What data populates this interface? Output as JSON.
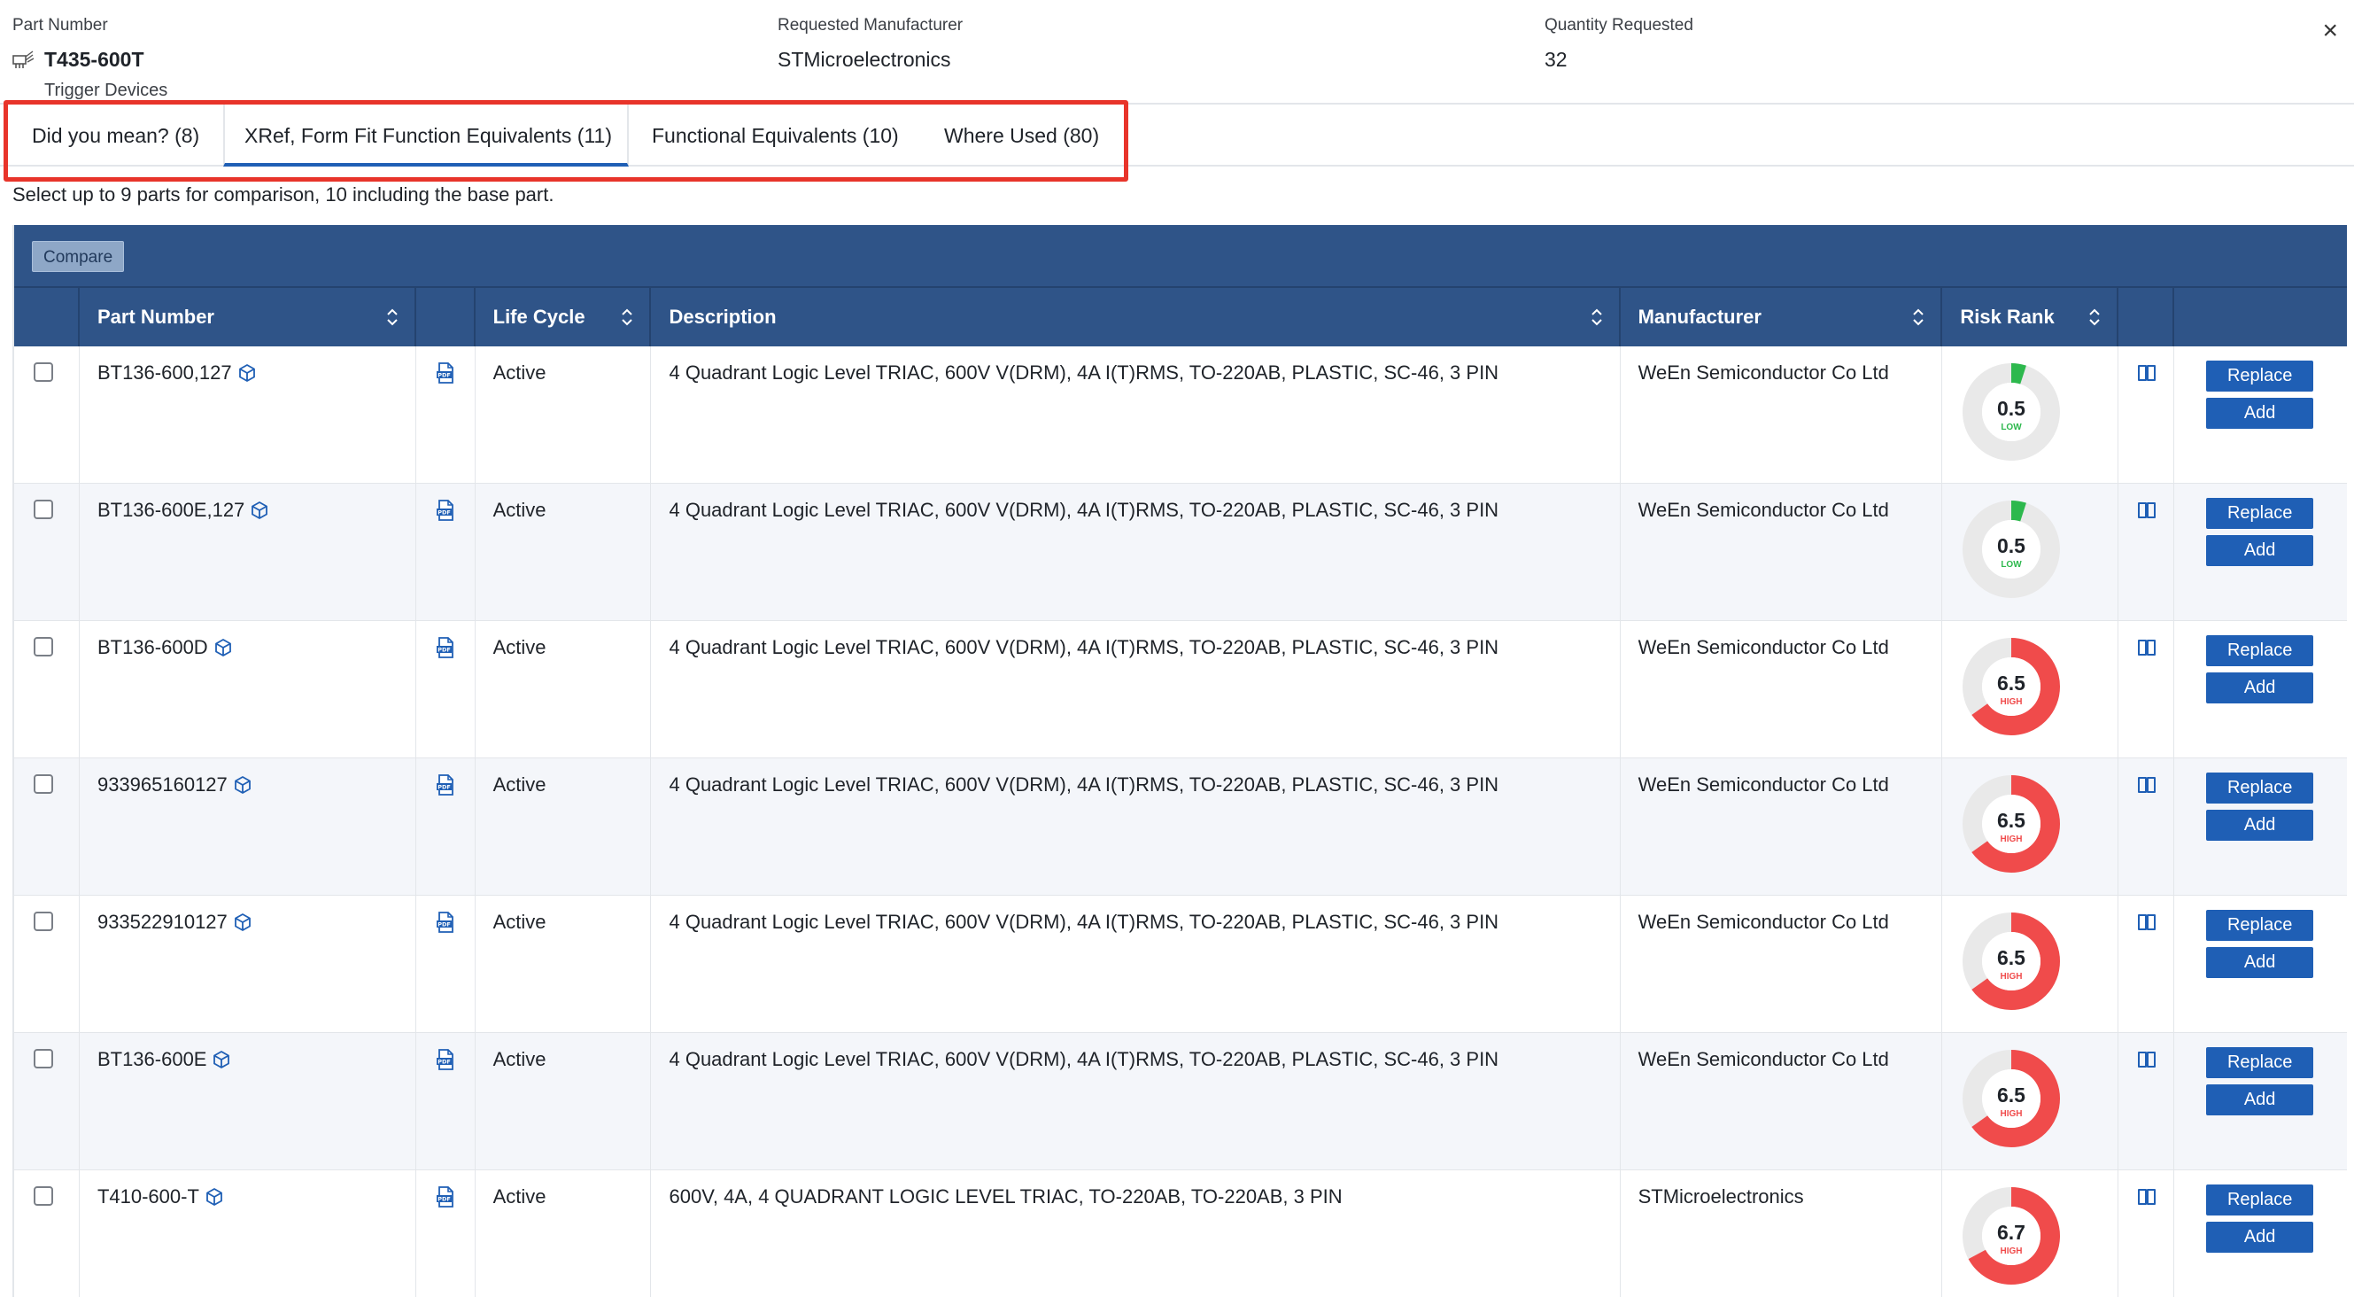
{
  "header": {
    "part_number_label": "Part Number",
    "part_number": "T435-600T",
    "part_category": "Trigger Devices",
    "manufacturer_label": "Requested Manufacturer",
    "manufacturer": "STMicroelectronics",
    "quantity_label": "Quantity Requested",
    "quantity": "32",
    "close_symbol": "×"
  },
  "tabs": [
    {
      "label": "Did you mean? (8)",
      "active": false
    },
    {
      "label": "XRef, Form Fit Function Equivalents (11)",
      "active": true
    },
    {
      "label": "Functional Equivalents (10)",
      "active": false
    },
    {
      "label": "Where Used (80)",
      "active": false
    }
  ],
  "hint": "Select up to 9 parts for comparison, 10 including the base part.",
  "toolbar": {
    "compare_label": "Compare"
  },
  "columns": {
    "part_number": "Part Number",
    "life_cycle": "Life Cycle",
    "description": "Description",
    "manufacturer": "Manufacturer",
    "risk_rank": "Risk Rank"
  },
  "actions": {
    "replace_label": "Replace",
    "add_label": "Add"
  },
  "risk_colors": {
    "low": "#2db84d",
    "high": "#f04b4b",
    "track": "#e9e9e9"
  },
  "rows": [
    {
      "part_number": "BT136-600,127",
      "life_cycle": "Active",
      "description": "4 Quadrant Logic Level TRIAC, 600V V(DRM), 4A I(T)RMS, TO-220AB, PLASTIC, SC-46, 3 PIN",
      "manufacturer": "WeEn Semiconductor Co Ltd",
      "risk_value": "0.5",
      "risk_level": "LOW",
      "risk_fraction": 0.05
    },
    {
      "part_number": "BT136-600E,127",
      "life_cycle": "Active",
      "description": "4 Quadrant Logic Level TRIAC, 600V V(DRM), 4A I(T)RMS, TO-220AB, PLASTIC, SC-46, 3 PIN",
      "manufacturer": "WeEn Semiconductor Co Ltd",
      "risk_value": "0.5",
      "risk_level": "LOW",
      "risk_fraction": 0.05
    },
    {
      "part_number": "BT136-600D",
      "life_cycle": "Active",
      "description": "4 Quadrant Logic Level TRIAC, 600V V(DRM), 4A I(T)RMS, TO-220AB, PLASTIC, SC-46, 3 PIN",
      "manufacturer": "WeEn Semiconductor Co Ltd",
      "risk_value": "6.5",
      "risk_level": "HIGH",
      "risk_fraction": 0.65
    },
    {
      "part_number": "933965160127",
      "life_cycle": "Active",
      "description": "4 Quadrant Logic Level TRIAC, 600V V(DRM), 4A I(T)RMS, TO-220AB, PLASTIC, SC-46, 3 PIN",
      "manufacturer": "WeEn Semiconductor Co Ltd",
      "risk_value": "6.5",
      "risk_level": "HIGH",
      "risk_fraction": 0.65
    },
    {
      "part_number": "933522910127",
      "life_cycle": "Active",
      "description": "4 Quadrant Logic Level TRIAC, 600V V(DRM), 4A I(T)RMS, TO-220AB, PLASTIC, SC-46, 3 PIN",
      "manufacturer": "WeEn Semiconductor Co Ltd",
      "risk_value": "6.5",
      "risk_level": "HIGH",
      "risk_fraction": 0.65
    },
    {
      "part_number": "BT136-600E",
      "life_cycle": "Active",
      "description": "4 Quadrant Logic Level TRIAC, 600V V(DRM), 4A I(T)RMS, TO-220AB, PLASTIC, SC-46, 3 PIN",
      "manufacturer": "WeEn Semiconductor Co Ltd",
      "risk_value": "6.5",
      "risk_level": "HIGH",
      "risk_fraction": 0.65
    },
    {
      "part_number": "T410-600-T",
      "life_cycle": "Active",
      "description": "600V, 4A, 4 QUADRANT LOGIC LEVEL TRIAC, TO-220AB, TO-220AB, 3 PIN",
      "manufacturer": "STMicroelectronics",
      "risk_value": "6.7",
      "risk_level": "HIGH",
      "risk_fraction": 0.67
    }
  ]
}
